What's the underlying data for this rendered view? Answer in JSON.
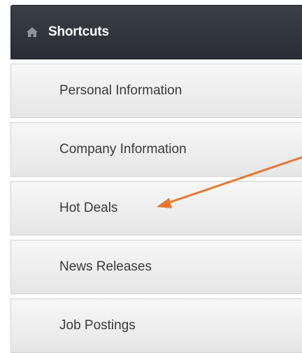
{
  "menu": {
    "header": {
      "title": "Shortcuts",
      "icon": "home-icon"
    },
    "items": [
      {
        "label": "Personal Information"
      },
      {
        "label": "Company Information"
      },
      {
        "label": "Hot Deals"
      },
      {
        "label": "News Releases"
      },
      {
        "label": "Job Postings"
      }
    ]
  },
  "annotation": {
    "arrow_color": "#e8772e"
  }
}
